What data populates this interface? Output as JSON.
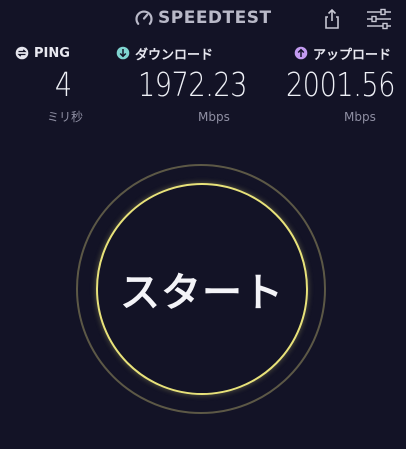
{
  "header": {
    "brand": "SPEEDTEST",
    "icons": {
      "brand": "speedometer-icon",
      "share": "share-icon",
      "settings": "sliders-icon"
    }
  },
  "metrics": {
    "ping": {
      "label": "PING",
      "value": "4",
      "unit": "ミリ秒",
      "icon": "ping-icon",
      "icon_color": "#e6e6ee"
    },
    "download": {
      "label": "ダウンロード",
      "value": "1972.23",
      "unit": "Mbps",
      "icon": "download-icon",
      "icon_color": "#7fd4d0"
    },
    "upload": {
      "label": "アップロード",
      "value": "2001.56",
      "unit": "Mbps",
      "icon": "upload-icon",
      "icon_color": "#c39bf0"
    }
  },
  "start_button": {
    "label": "スタート",
    "ring_color": "#e8e27a"
  }
}
